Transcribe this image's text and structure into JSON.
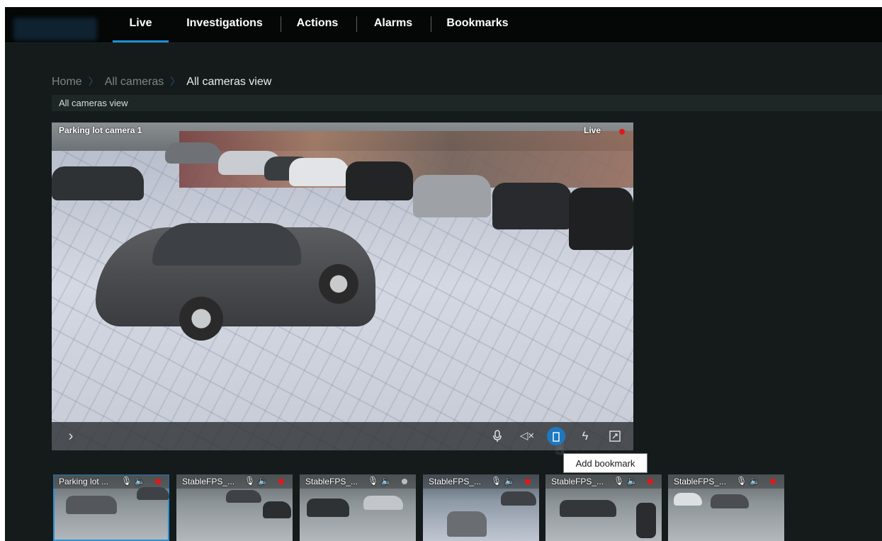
{
  "nav": {
    "tabs": [
      {
        "label": "Live",
        "active": true
      },
      {
        "label": "Investigations"
      },
      {
        "label": "Actions"
      },
      {
        "label": "Alarms"
      },
      {
        "label": "Bookmarks"
      }
    ]
  },
  "breadcrumb": {
    "items": [
      "Home",
      "All cameras",
      "All cameras view"
    ],
    "separator": "〉"
  },
  "view": {
    "title": "All cameras view"
  },
  "main_video": {
    "camera_name": "Parking lot camera 1",
    "status": "Live",
    "controls": {
      "expand": "chevron-right-icon",
      "mic": "microphone-icon",
      "mute": "speaker-muted-icon",
      "bookmark": "bookmark-icon",
      "trigger": "lightning-icon",
      "fullscreen": "fullscreen-icon"
    }
  },
  "tooltip": {
    "text": "Add bookmark"
  },
  "thumbnails": [
    {
      "label": "Parking lot ...",
      "selected": true,
      "rec_color": "#e11818"
    },
    {
      "label": "StableFPS_...",
      "rec_color": "#e11818"
    },
    {
      "label": "StableFPS_...",
      "rec_color": "#bdbdbd"
    },
    {
      "label": "StableFPS_...",
      "rec_color": "#e11818"
    },
    {
      "label": "StableFPS_...",
      "rec_color": "#e11818"
    },
    {
      "label": "StableFPS_...",
      "rec_color": "#e11818"
    }
  ],
  "colors": {
    "accent": "#1e90d6",
    "recording": "#e11818",
    "background": "#151b1b"
  }
}
